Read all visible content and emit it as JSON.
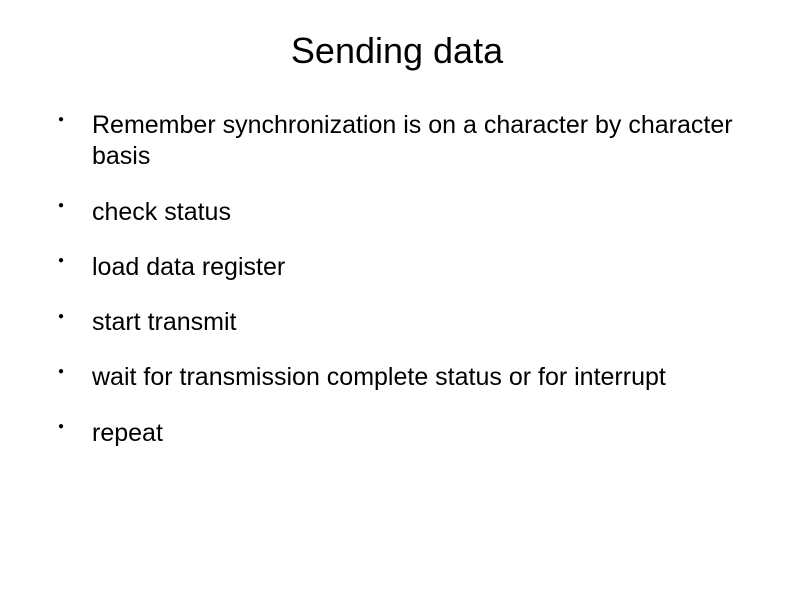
{
  "title": "Sending data",
  "bullets": [
    "Remember synchronization is on a character by character basis",
    "check status",
    "load data register",
    "start transmit",
    "wait for transmission complete status or for interrupt",
    "repeat"
  ]
}
